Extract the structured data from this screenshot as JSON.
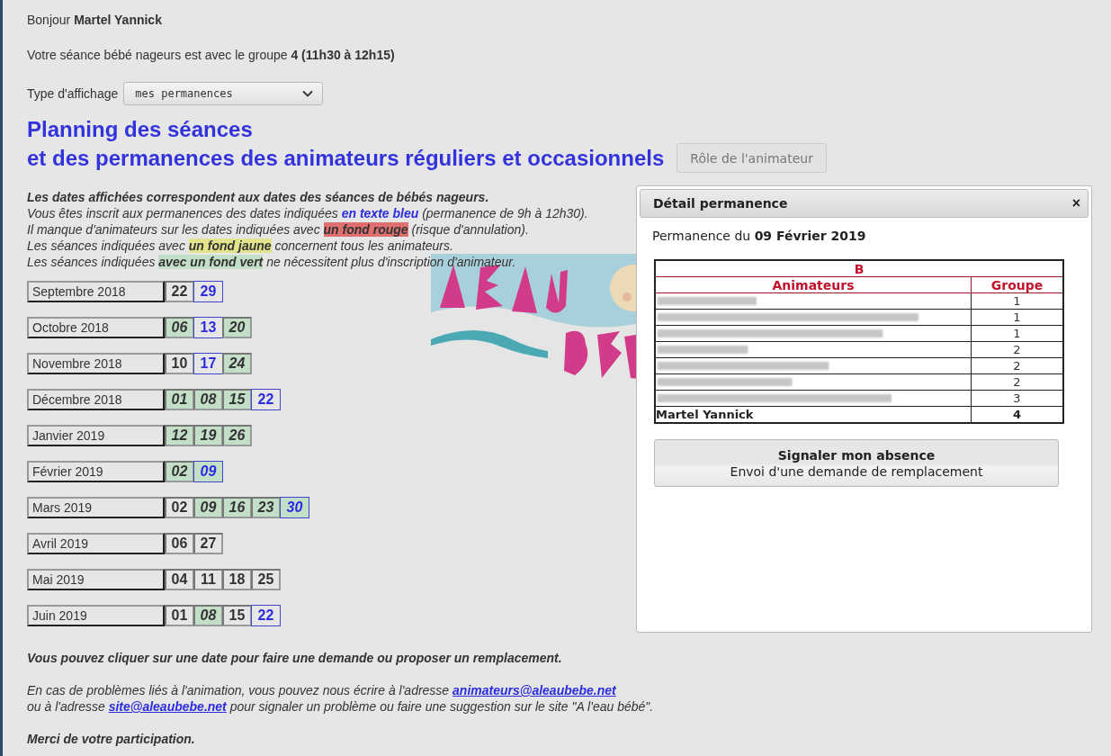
{
  "greeting": "Bonjour **Martel Yannick**",
  "session": "Votre séance bébé nageurs est avec le groupe **4 (11h30 à 12h15)**",
  "display_type": {
    "label": "Type d'affichage",
    "value": "mes permanences"
  },
  "title_lines": [
    "Planning des séances",
    "et des permanences des animateurs réguliers et occasionnels"
  ],
  "role_button": "Rôle de l'animateur",
  "legend": [
    [
      {
        "text": "Les dates affichées correspondent aux dates des séances de bébés nageurs.",
        "kind": "bold"
      }
    ],
    [
      {
        "text": "Vous êtes inscrit aux permanences des dates indiquées ",
        "kind": "plain"
      },
      {
        "text": "en texte bleu",
        "kind": "blue"
      },
      {
        "text": " (permanence de 9h à 12h30).",
        "kind": "plain"
      }
    ],
    [
      {
        "text": "Il manque d'animateurs sur les dates indiquées avec ",
        "kind": "plain"
      },
      {
        "text": "un fond rouge",
        "kind": "red"
      },
      {
        "text": " (risque d'annulation).",
        "kind": "plain"
      }
    ],
    [
      {
        "text": "Les séances indiquées avec ",
        "kind": "plain"
      },
      {
        "text": "un fond jaune",
        "kind": "yellow"
      },
      {
        "text": " concernent tous les animateurs.",
        "kind": "plain"
      }
    ],
    [
      {
        "text": "Les séances indiquées ",
        "kind": "plain"
      },
      {
        "text": "avec un fond vert",
        "kind": "green"
      },
      {
        "text": " ne nécessitent plus d'inscription d'animateur.",
        "kind": "plain"
      }
    ]
  ],
  "months": [
    {
      "label": "Septembre 2018",
      "dates": [
        {
          "day": "22",
          "registered": false,
          "covered": false
        },
        {
          "day": "29",
          "registered": true,
          "covered": false
        }
      ]
    },
    {
      "label": "Octobre 2018",
      "dates": [
        {
          "day": "06",
          "registered": false,
          "covered": true
        },
        {
          "day": "13",
          "registered": true,
          "covered": false
        },
        {
          "day": "20",
          "registered": false,
          "covered": true
        }
      ]
    },
    {
      "label": "Novembre 2018",
      "dates": [
        {
          "day": "10",
          "registered": false,
          "covered": false
        },
        {
          "day": "17",
          "registered": true,
          "covered": false
        },
        {
          "day": "24",
          "registered": false,
          "covered": true
        }
      ]
    },
    {
      "label": "Décembre 2018",
      "dates": [
        {
          "day": "01",
          "registered": false,
          "covered": true
        },
        {
          "day": "08",
          "registered": false,
          "covered": true
        },
        {
          "day": "15",
          "registered": false,
          "covered": true
        },
        {
          "day": "22",
          "registered": true,
          "covered": false
        }
      ]
    },
    {
      "label": "Janvier 2019",
      "dates": [
        {
          "day": "12",
          "registered": false,
          "covered": true
        },
        {
          "day": "19",
          "registered": false,
          "covered": true
        },
        {
          "day": "26",
          "registered": false,
          "covered": true
        }
      ]
    },
    {
      "label": "Février 2019",
      "dates": [
        {
          "day": "02",
          "registered": false,
          "covered": true
        },
        {
          "day": "09",
          "registered": true,
          "covered": true
        }
      ]
    },
    {
      "label": "Mars 2019",
      "dates": [
        {
          "day": "02",
          "registered": false,
          "covered": false
        },
        {
          "day": "09",
          "registered": false,
          "covered": true
        },
        {
          "day": "16",
          "registered": false,
          "covered": true
        },
        {
          "day": "23",
          "registered": false,
          "covered": true
        },
        {
          "day": "30",
          "registered": true,
          "covered": true
        }
      ]
    },
    {
      "label": "Avril 2019",
      "dates": [
        {
          "day": "06",
          "registered": false,
          "covered": false
        },
        {
          "day": "27",
          "registered": false,
          "covered": false
        }
      ]
    },
    {
      "label": "Mai 2019",
      "dates": [
        {
          "day": "04",
          "registered": false,
          "covered": false
        },
        {
          "day": "11",
          "registered": false,
          "covered": false
        },
        {
          "day": "18",
          "registered": false,
          "covered": false
        },
        {
          "day": "25",
          "registered": false,
          "covered": false
        }
      ]
    },
    {
      "label": "Juin 2019",
      "dates": [
        {
          "day": "01",
          "registered": false,
          "covered": false
        },
        {
          "day": "08",
          "registered": false,
          "covered": true
        },
        {
          "day": "15",
          "registered": false,
          "covered": false
        },
        {
          "day": "22",
          "registered": true,
          "covered": false
        }
      ]
    }
  ],
  "footer": [
    [
      [
        {
          "text": "Vous pouvez cliquer sur une date pour faire une demande ou proposer un remplacement.",
          "kind": "bold"
        }
      ]
    ],
    [
      [
        {
          "text": "En cas de problèmes liés à l'animation, vous pouvez nous écrire à l'adresse ",
          "kind": "plain"
        },
        {
          "text": "animateurs@aleaubebe.net",
          "kind": "link"
        }
      ],
      [
        {
          "text": "ou à l'adresse ",
          "kind": "plain"
        },
        {
          "text": "site@aleaubebe.net",
          "kind": "link"
        },
        {
          "text": " pour signaler un problème ou faire une suggestion sur le site \"A l'eau bébé\".",
          "kind": "plain"
        }
      ]
    ],
    [
      [
        {
          "text": "Merci de votre participation.",
          "kind": "bold"
        }
      ]
    ]
  ],
  "popup": {
    "title": "Détail permanence",
    "close": "×",
    "subtitle": "Permanence du **09 Février 2019**",
    "table": {
      "caption": "B",
      "columns": [
        "Animateurs",
        "Groupe"
      ],
      "rows": [
        {
          "kind": "blurred",
          "group": "1"
        },
        {
          "kind": "blurred",
          "group": "1"
        },
        {
          "kind": "blurred",
          "group": "1"
        },
        {
          "kind": "blurred",
          "group": "2"
        },
        {
          "kind": "blurred",
          "group": "2"
        },
        {
          "kind": "blurred",
          "group": "2"
        },
        {
          "kind": "blurred",
          "group": "3"
        },
        {
          "kind": "named",
          "name": "Martel Yannick",
          "group": "4"
        }
      ]
    },
    "action": {
      "title": "Signaler mon absence",
      "subtitle": "Envoi d'une demande de remplacement"
    }
  }
}
